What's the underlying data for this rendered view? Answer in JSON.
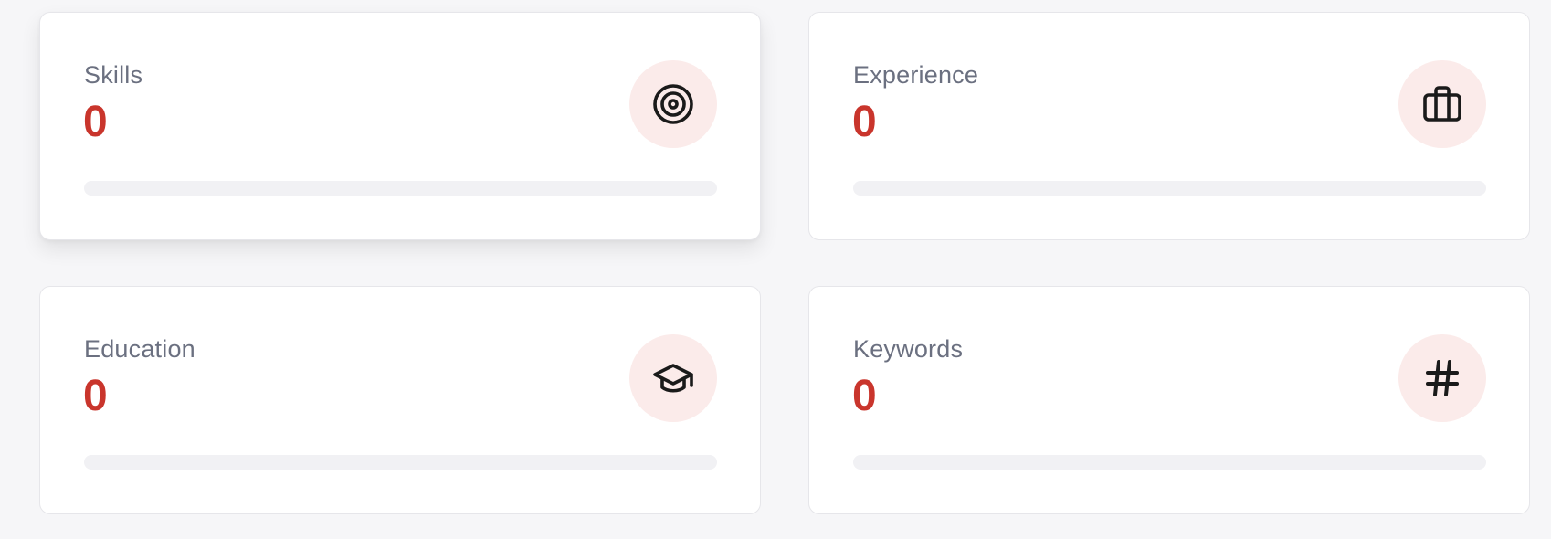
{
  "stats": [
    {
      "label": "Skills",
      "value": "0",
      "icon": "target-icon",
      "progress": 0
    },
    {
      "label": "Experience",
      "value": "0",
      "icon": "briefcase-icon",
      "progress": 0
    },
    {
      "label": "Education",
      "value": "0",
      "icon": "graduation-cap-icon",
      "progress": 0
    },
    {
      "label": "Keywords",
      "value": "0",
      "icon": "hash-icon",
      "progress": 0
    }
  ],
  "colors": {
    "value": "#c9352c",
    "icon_background": "#fbebea",
    "track": "#f1f1f4",
    "page_background": "#f6f6f8"
  }
}
